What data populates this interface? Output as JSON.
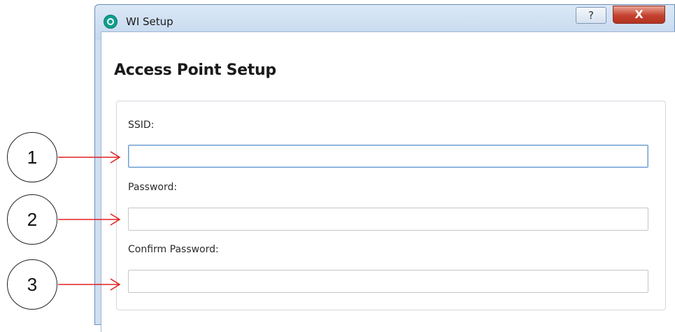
{
  "window": {
    "title": "WI Setup",
    "help_label": "?",
    "close_label": "X"
  },
  "page": {
    "heading": "Access Point Setup"
  },
  "form": {
    "ssid_label": "SSID:",
    "ssid_value": "",
    "password_label": "Password:",
    "password_value": "",
    "confirm_label": "Confirm Password:",
    "confirm_value": ""
  },
  "callouts": [
    "1",
    "2",
    "3"
  ],
  "colors": {
    "arrow": "#e02020",
    "close_button": "#c4412e",
    "focus_border": "#6c9dd0",
    "app_icon": "#0f9e8e"
  }
}
